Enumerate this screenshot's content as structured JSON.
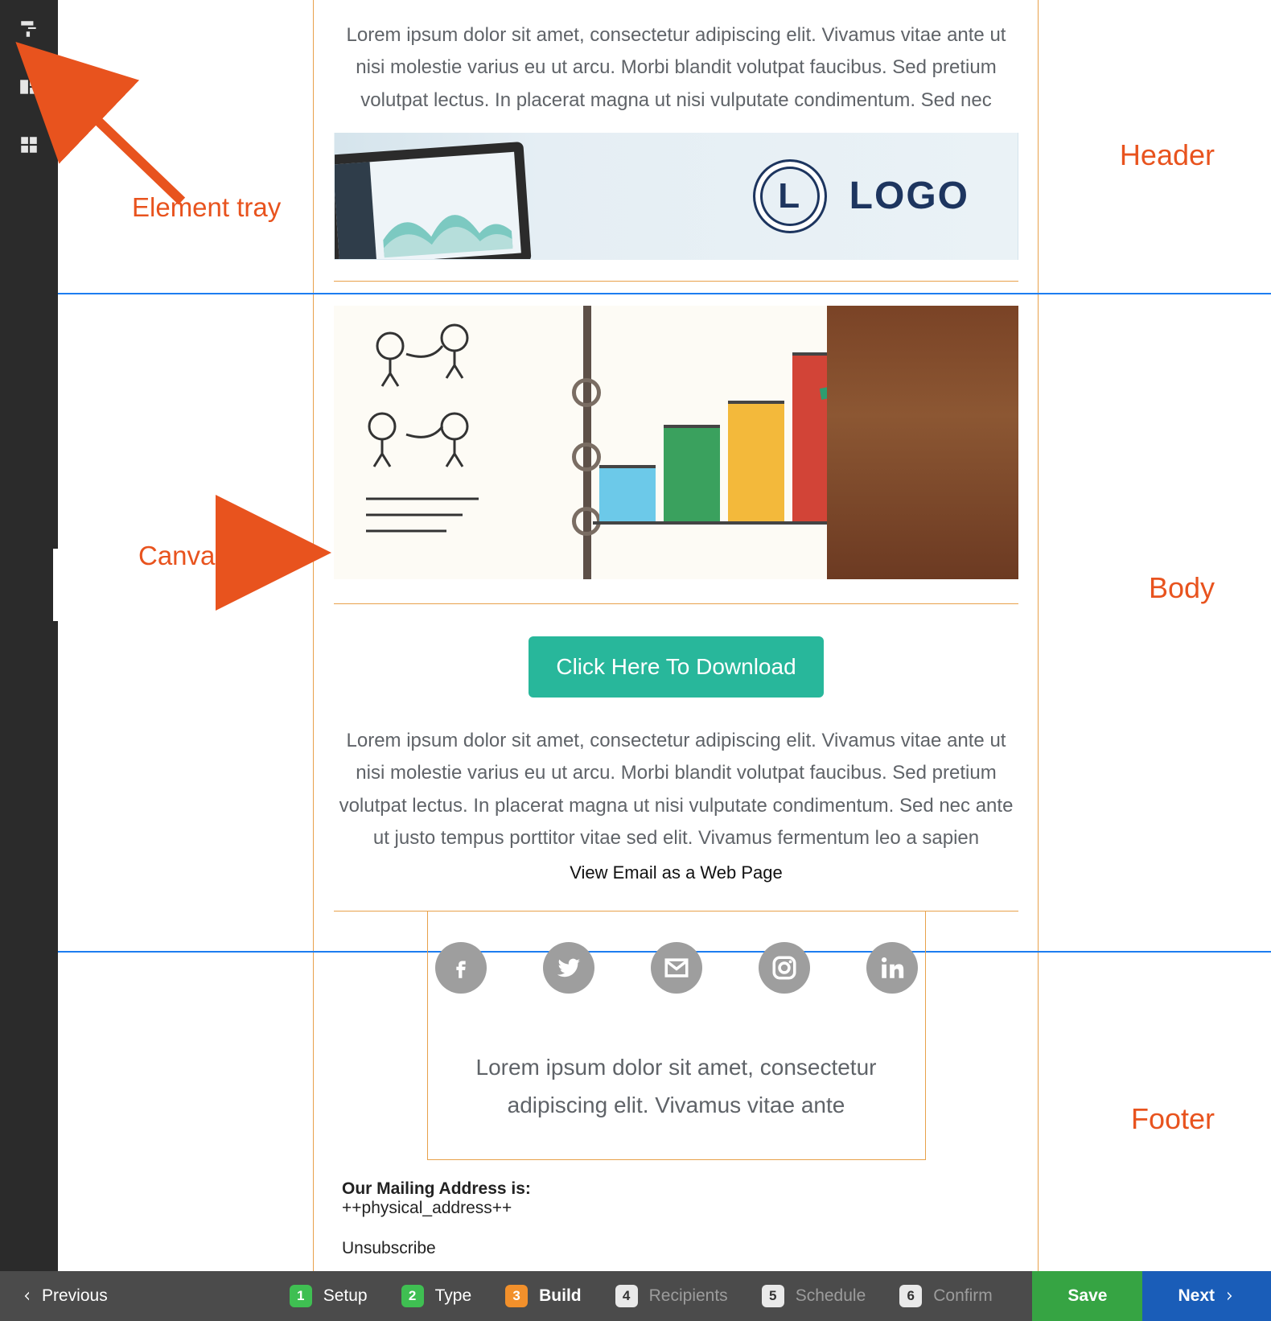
{
  "annotations": {
    "element_tray": "Element tray",
    "canvas": "Canvas",
    "header": "Header",
    "body": "Body",
    "footer": "Footer"
  },
  "sidebar": {
    "tools": [
      {
        "name": "paint-roller-icon"
      },
      {
        "name": "layout-columns-icon"
      },
      {
        "name": "grid-icon"
      }
    ]
  },
  "email": {
    "header_text": "Lorem ipsum dolor sit amet, consectetur adipiscing elit. Vivamus vitae ante ut nisi molestie varius eu ut arcu. Morbi blandit volutpat faucibus. Sed pretium volutpat lectus. In placerat magna ut nisi vulputate condimentum. Sed nec",
    "logo_text": "LOGO",
    "logo_letter": "L",
    "cta_label": "Click Here To Download",
    "body_text": "Lorem ipsum dolor sit amet, consectetur adipiscing elit. Vivamus vitae ante ut nisi molestie varius eu ut arcu. Morbi blandit volutpat faucibus. Sed pretium volutpat lectus. In placerat magna ut nisi vulputate condimentum. Sed nec ante ut justo tempus porttitor vitae sed elit. Vivamus fermentum leo a sapien",
    "web_link": "View Email as a Web Page",
    "footer_center_text": "Lorem ipsum dolor sit amet, consectetur adipiscing elit. Vivamus vitae ante",
    "mailing_label": "Our Mailing Address is:",
    "mailing_value": "++physical_address++",
    "unsubscribe": "Unsubscribe",
    "social": [
      "facebook",
      "twitter",
      "email",
      "instagram",
      "linkedin"
    ]
  },
  "stepbar": {
    "previous": "Previous",
    "save": "Save",
    "next": "Next",
    "steps": [
      {
        "n": "1",
        "label": "Setup",
        "state": "done"
      },
      {
        "n": "2",
        "label": "Type",
        "state": "done"
      },
      {
        "n": "3",
        "label": "Build",
        "state": "active"
      },
      {
        "n": "4",
        "label": "Recipients",
        "state": "pending"
      },
      {
        "n": "5",
        "label": "Schedule",
        "state": "pending"
      },
      {
        "n": "6",
        "label": "Confirm",
        "state": "pending"
      }
    ]
  },
  "colors": {
    "accent_orange": "#e8531e",
    "border_orange": "#e8a14b",
    "rule_blue": "#1d7df0",
    "cta_teal": "#28b79b",
    "save_green": "#36a443",
    "next_blue": "#1a5db8"
  }
}
